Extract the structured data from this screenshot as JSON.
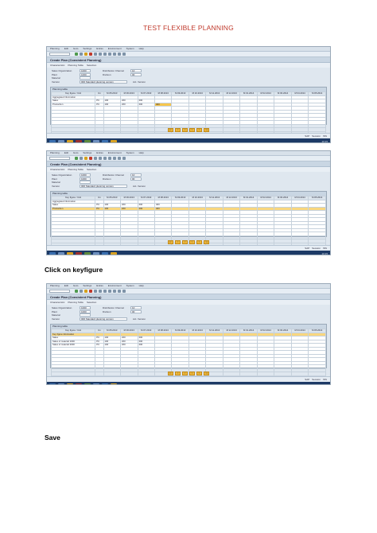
{
  "doc": {
    "title": "TEST FLEXIBLE PLANNING",
    "caption1": "Click on keyfigure",
    "caption2": "Save"
  },
  "sap": {
    "menu": [
      "Planning",
      "Edit",
      "Goto",
      "Settings",
      "Extras",
      "Environment",
      "System",
      "Help"
    ],
    "screen_title": "Create Plan (Consistent Planning)",
    "app_buttons": [
      "Characteristic",
      "Planning Table",
      "Selection"
    ],
    "form": {
      "labels": [
        "Sales Organization",
        "Plant",
        "Material",
        "Version"
      ],
      "values": [
        "1000",
        "1000",
        "",
        "000 Standard planning version"
      ],
      "right_labels": [
        "Distribution Channel",
        "Division"
      ],
      "right_values": [
        "10",
        "00"
      ],
      "act_label": "Act. Version"
    },
    "grid_title": "Planning table",
    "columns": [
      "Key figure / Unit",
      "Un",
      "M 05.2013",
      "M 06.2013",
      "M 07.2013",
      "M 08.2013",
      "M 09.2013",
      "M 10.2013",
      "M 11.2013",
      "M 12.2013",
      "M 01.2014",
      "M 02.2014",
      "M 03.2014",
      "M 04.2014",
      "M 05.2014"
    ],
    "screen1_rows": [
      [
        "Aggregated information",
        "",
        "",
        "",
        "",
        "",
        "",
        "",
        "",
        "",
        "",
        "",
        "",
        "",
        ""
      ],
      [
        "Sales",
        "PC",
        "100",
        "200",
        "300",
        "",
        "",
        "",
        "",
        "",
        "",
        "",
        "",
        "",
        ""
      ],
      [
        "Production",
        "PC",
        "100",
        "200",
        "300",
        "400",
        "",
        "",
        "",
        "",
        "",
        "",
        "",
        "",
        ""
      ]
    ],
    "screen2_rows": [
      [
        "Aggregated information",
        "",
        "",
        "",
        "",
        "",
        "",
        "",
        "",
        "",
        "",
        "",
        "",
        "",
        ""
      ],
      [
        "Sales",
        "PC",
        "100",
        "200",
        "300",
        "400",
        "",
        "",
        "",
        "",
        "",
        "",
        "",
        "",
        ""
      ],
      [
        "Production",
        "PC",
        "100",
        "200",
        "300",
        "400",
        "",
        "",
        "",
        "",
        "",
        "",
        "",
        "",
        ""
      ]
    ],
    "screen3_rows": [
      [
        "Key figure information",
        "",
        "",
        "",
        "",
        "",
        "",
        "",
        "",
        "",
        "",
        "",
        "",
        "",
        ""
      ],
      [
        "Sales",
        "PC",
        "100",
        "200",
        "300",
        "",
        "",
        "",
        "",
        "",
        "",
        "",
        "",
        "",
        ""
      ],
      [
        "Sales of material 1000",
        "PC",
        "100",
        "200",
        "300",
        "",
        "",
        "",
        "",
        "",
        "",
        "",
        "",
        "",
        ""
      ],
      [
        "Sales of material 2000",
        "PC",
        "100",
        "200",
        "300",
        "",
        "",
        "",
        "",
        "",
        "",
        "",
        "",
        "",
        ""
      ]
    ],
    "nav_buttons": [
      "|<",
      "<",
      "<",
      ">",
      ">",
      ">|"
    ],
    "status": [
      "SAP",
      "Session",
      "INS"
    ],
    "clock": "10:15"
  }
}
